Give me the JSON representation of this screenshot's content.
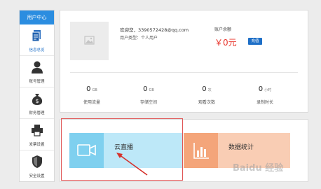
{
  "sidebar": {
    "header": "用户中心",
    "items": [
      {
        "label": "信息总览",
        "icon": "document-icon",
        "active": true
      },
      {
        "label": "账号管理",
        "icon": "user-icon",
        "active": false
      },
      {
        "label": "财务管理",
        "icon": "money-bag-icon",
        "active": false
      },
      {
        "label": "发票设置",
        "icon": "printer-icon",
        "active": false
      },
      {
        "label": "安全设置",
        "icon": "shield-icon",
        "active": false
      }
    ]
  },
  "account": {
    "email": "欢迎您，3390572428@qq.com",
    "user_type": "用户类型：个人用户",
    "balance_label": "账户余额",
    "balance_value": "￥0元",
    "recharge_label": "充值"
  },
  "stats": [
    {
      "value": "0",
      "unit": "GB",
      "label": "使用流量"
    },
    {
      "value": "0",
      "unit": "GB",
      "label": "存储空间"
    },
    {
      "value": "0",
      "unit": "次",
      "label": "观看次数"
    },
    {
      "value": "0",
      "unit": "小时",
      "label": "录制时长"
    }
  ],
  "cards": [
    {
      "title": "云直播",
      "icon": "video-camera-icon"
    },
    {
      "title": "数据统计",
      "icon": "bar-chart-icon"
    }
  ],
  "watermark": "Baidu 经验",
  "colors": {
    "accent": "#2b8de0",
    "balance": "#e8332a",
    "live_card_left": "#7fd0ef",
    "live_card_right": "#bde8f8",
    "stats_card_left": "#f4a57a",
    "stats_card_right": "#f9cdb4"
  }
}
